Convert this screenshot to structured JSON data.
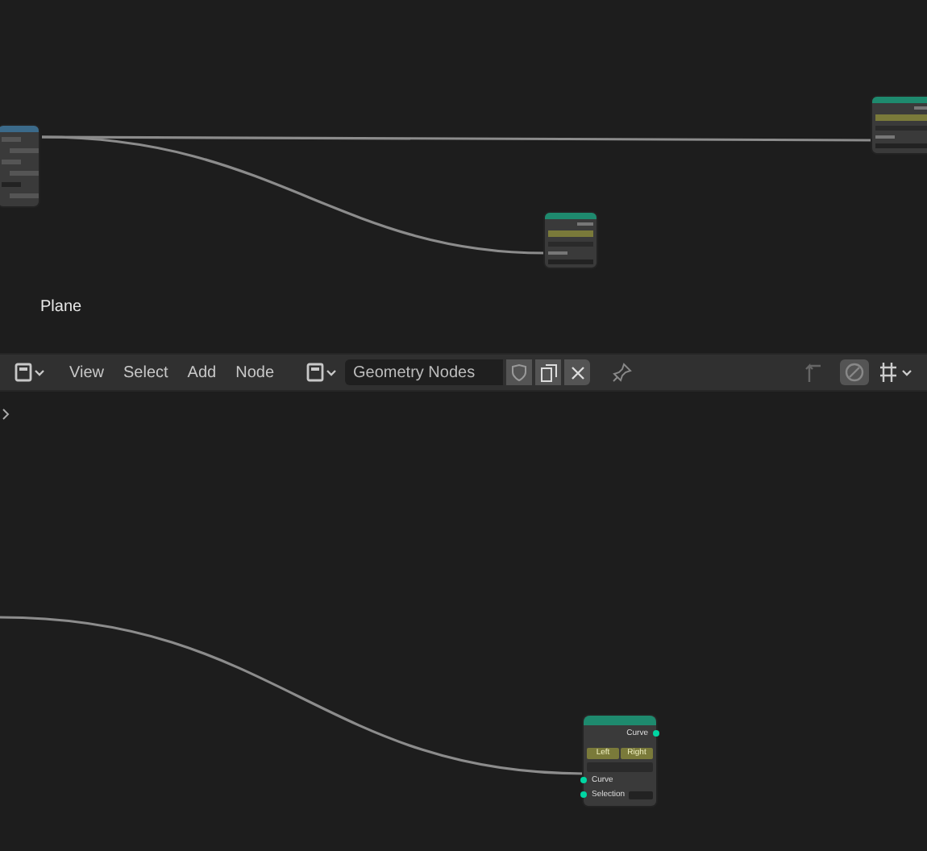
{
  "top_editor": {
    "object_label": "Plane"
  },
  "header": {
    "menus": [
      "View",
      "Select",
      "Add",
      "Node"
    ],
    "node_tree_name": "Geometry Nodes"
  },
  "bottom_node": {
    "outputs": [
      "Curve"
    ],
    "handle_buttons": [
      {
        "label": "Left",
        "selected": true
      },
      {
        "label": "Right",
        "selected": true
      }
    ],
    "inputs": [
      "Curve",
      "Selection"
    ]
  }
}
